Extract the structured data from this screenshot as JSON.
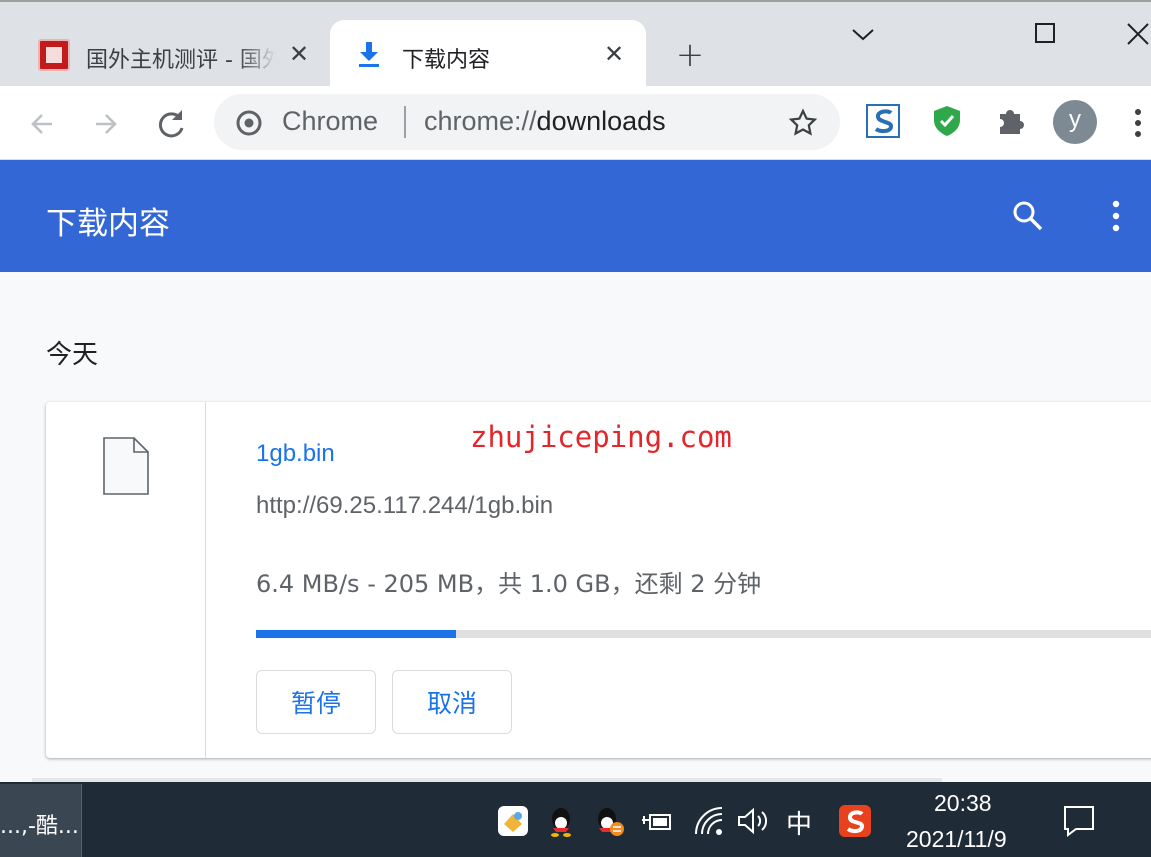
{
  "tabs": [
    {
      "title": "国外主机测评 - 国外VPS，国外",
      "close": "✕",
      "icon": "site-favicon"
    },
    {
      "title": "下载内容",
      "close": "✕",
      "icon": "download-icon"
    }
  ],
  "new_tab": "+",
  "window_controls": {
    "minimize": "chevron-down-icon",
    "maximize": "square-icon",
    "close": "close-icon"
  },
  "omnibox": {
    "site_label": "Chrome",
    "url_scheme": "chrome://",
    "url_host": "downloads"
  },
  "extensions": [
    "s-extension-icon",
    "shield-check-icon",
    "puzzle-icon"
  ],
  "profile": {
    "initial": "y",
    "color": "#7d8a93"
  },
  "header": {
    "title": "下载内容",
    "color": "#3367d6"
  },
  "section": {
    "date": "今天"
  },
  "download": {
    "file_name": "1gb.bin",
    "url": "http://69.25.117.244/1gb.bin",
    "status": "6.4 MB/s - 205 MB，共 1.0 GB，还剩 2 分钟",
    "progress_fraction": 0.22,
    "pause_label": "暂停",
    "cancel_label": "取消"
  },
  "watermark": "zhujiceping.com",
  "taskbar": {
    "app_label": "...,-酷...",
    "ime": "中",
    "time": "20:38",
    "date": "2021/11/9"
  },
  "colors": {
    "accent": "#1a73e8",
    "header": "#3367d6",
    "watermark": "#e3262b"
  }
}
